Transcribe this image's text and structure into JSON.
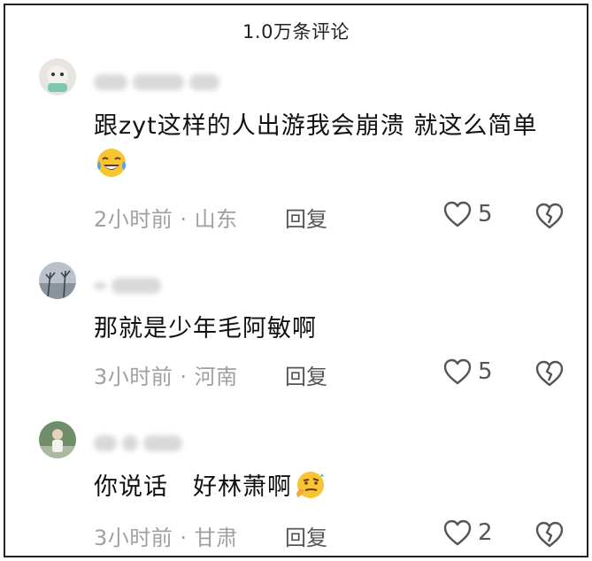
{
  "header": {
    "title": "1.0万条评论"
  },
  "comments": [
    {
      "text": "跟zyt这样的人出游我会崩溃 就这么简单",
      "emoji": "laughing-crying-emoji",
      "time": "2小时前",
      "separator": " · ",
      "location": "山东",
      "reply_label": "回复",
      "like_count": "5"
    },
    {
      "text": "那就是少年毛阿敏啊",
      "time": "3小时前",
      "separator": " · ",
      "location": "河南",
      "reply_label": "回复",
      "like_count": "5"
    },
    {
      "text": "你说话　好林萧啊",
      "emoji": "thinking-smirk-emoji",
      "time": "3小时前",
      "separator": " · ",
      "location": "甘肃",
      "reply_label": "回复",
      "like_count": "2"
    }
  ],
  "icons": {
    "like": "heart-outline-icon",
    "dislike": "broken-heart-icon"
  },
  "colors": {
    "text": "#111111",
    "meta": "#a0a0a0",
    "icon": "#555555",
    "frame": "#222222"
  }
}
